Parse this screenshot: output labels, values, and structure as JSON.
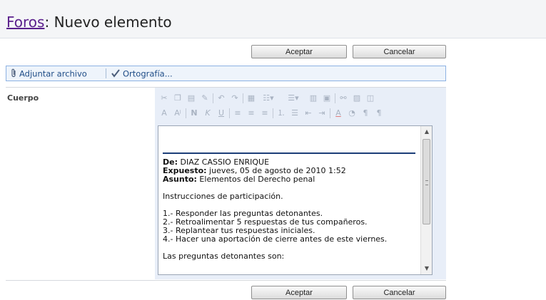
{
  "header": {
    "link": "Foros",
    "title_rest": ": Nuevo elemento"
  },
  "buttons": {
    "ok": "Aceptar",
    "cancel": "Cancelar"
  },
  "toolbar": {
    "attach": "Adjuntar archivo",
    "spelling": "Ortografía..."
  },
  "form": {
    "body_label": "Cuerpo"
  },
  "message": {
    "from_label": "De:",
    "from_value": " DIAZ CASSIO ENRIQUE",
    "posted_label": "Expuesto:",
    "posted_value": " jueves, 05 de agosto de 2010 1:52",
    "subject_label": "Asunto:",
    "subject_value": " Elementos del Derecho penal",
    "intro": "Instrucciones de participación.",
    "items": [
      "1.- Responder las preguntas detonantes.",
      "2.- Retroalimentar 5 respuestas de tus compañeros.",
      "3.- Replantear tus respuestas iniciales.",
      "4.- Hacer una aportación de cierre antes de este viernes."
    ],
    "closing": "Las preguntas detonantes son:"
  },
  "icons": {
    "attach": "paperclip-icon",
    "spelling": "abc-spellcheck-icon"
  }
}
